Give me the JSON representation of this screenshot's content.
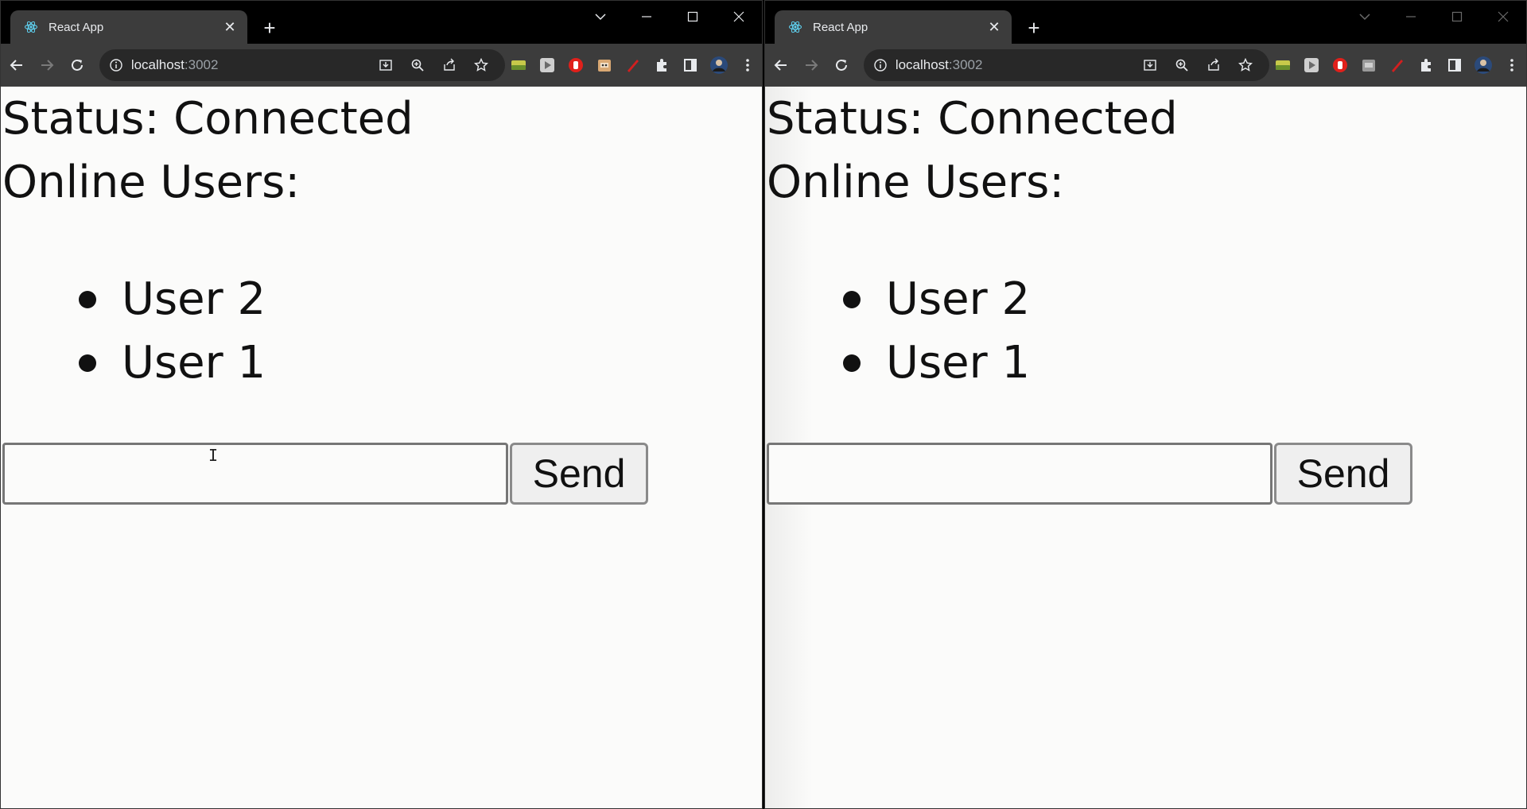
{
  "windows": [
    {
      "tab_title": "React App",
      "url_host": "localhost",
      "url_port": ":3002",
      "status_text": "Status: Connected",
      "online_label": "Online Users:",
      "users": [
        "User 2",
        "User 1"
      ],
      "input_value": "",
      "send_label": "Send"
    },
    {
      "tab_title": "React App",
      "url_host": "localhost",
      "url_port": ":3002",
      "status_text": "Status: Connected",
      "online_label": "Online Users:",
      "users": [
        "User 2",
        "User 1"
      ],
      "input_value": "",
      "send_label": "Send"
    }
  ],
  "icons": {
    "favicon": "react-icon",
    "close": "close-icon",
    "new_tab": "plus-icon",
    "back": "back-arrow-icon",
    "forward": "forward-arrow-icon",
    "reload": "reload-icon",
    "info": "info-icon",
    "install": "install-icon",
    "zoom": "zoom-icon",
    "share": "share-icon",
    "bookmark": "star-icon",
    "extensions": "puzzle-icon",
    "side_panel": "side-panel-icon",
    "profile": "avatar",
    "menu": "kebab-menu-icon"
  },
  "colors": {
    "tab_bg": "#3c3c3c",
    "titlebar_bg": "#000000",
    "page_bg": "#fbfbfa",
    "text": "#111111"
  }
}
